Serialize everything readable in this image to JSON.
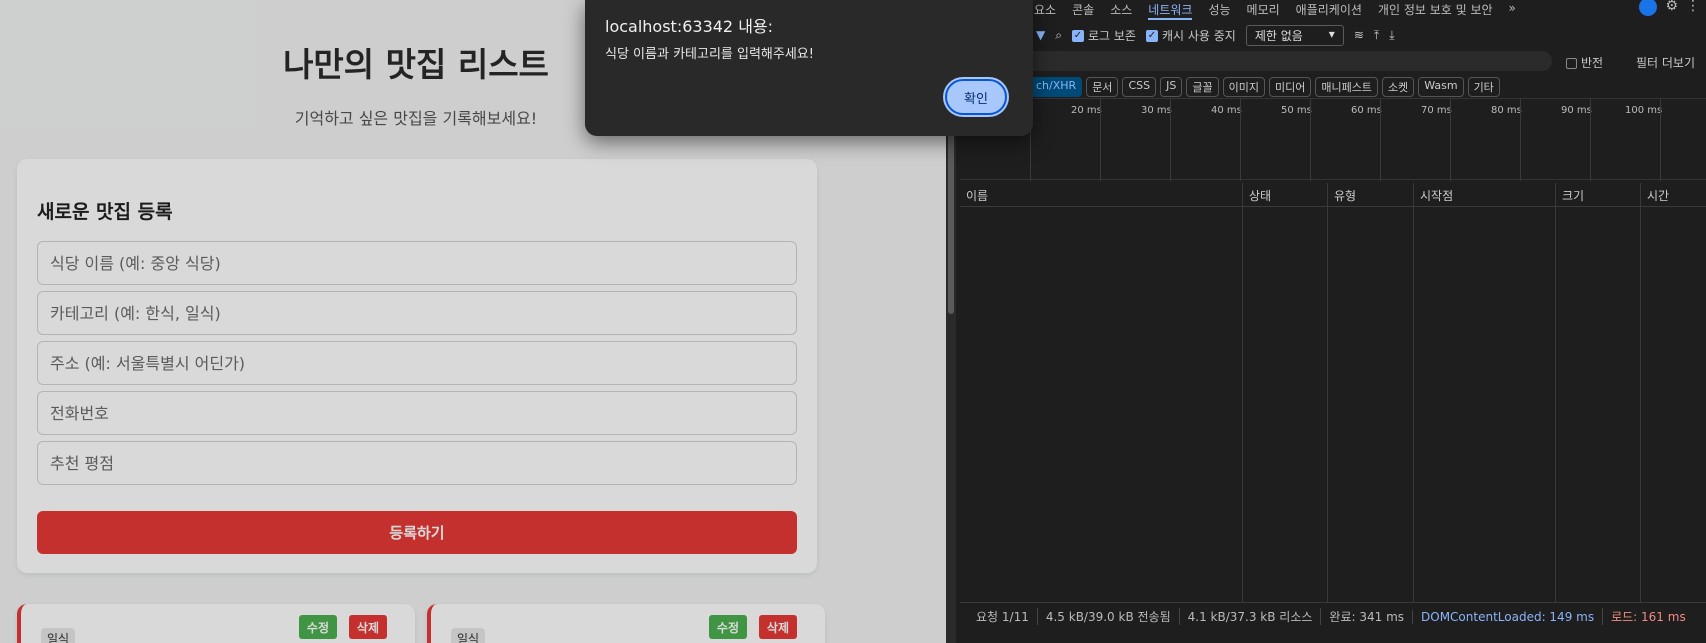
{
  "page": {
    "title": "나만의 맛집 리스트",
    "subtitle": "기억하고 싶은 맛집을 기록해보세요!",
    "form": {
      "title": "새로운 맛집 등록",
      "fields": [
        {
          "placeholder": "식당 이름 (예: 중앙 식당)"
        },
        {
          "placeholder": "카테고리 (예: 한식, 일식)"
        },
        {
          "placeholder": "주소 (예: 서울특별시 어딘가)"
        },
        {
          "placeholder": "전화번호"
        },
        {
          "placeholder": "추천 평점"
        }
      ],
      "submit_label": "등록하기"
    },
    "items": [
      {
        "category": "일식",
        "edit_label": "수정",
        "delete_label": "삭제"
      },
      {
        "category": "일식",
        "edit_label": "수정",
        "delete_label": "삭제"
      }
    ],
    "accent_color": "#e53935",
    "edit_color": "#4caf50"
  },
  "dialog": {
    "title": "localhost:63342 내용:",
    "message": "식당 이름과 카테고리를 입력해주세요!",
    "ok_label": "확인"
  },
  "devtools": {
    "tabs": [
      "요소",
      "콘솔",
      "소스",
      "네트워크",
      "성능",
      "메모리",
      "애플리케이션",
      "개인 정보 보호 및 보안"
    ],
    "active_tab": "네트워크",
    "toolbar": {
      "preserve_log": "로그 보존",
      "disable_cache": "캐시 사용 중지",
      "throttle_value": "제한 없음",
      "invert_label": "반전",
      "more_filters": "필터 더보기"
    },
    "filter_chips": [
      "ch/XHR",
      "문서",
      "CSS",
      "JS",
      "글꼴",
      "이미지",
      "미디어",
      "매니페스트",
      "소켓",
      "Wasm",
      "기타"
    ],
    "timeline_ticks": [
      "20 ms",
      "30 ms",
      "40 ms",
      "50 ms",
      "60 ms",
      "70 ms",
      "80 ms",
      "90 ms",
      "100 ms"
    ],
    "columns": [
      "이름",
      "상태",
      "유형",
      "시작점",
      "크기",
      "시간"
    ],
    "status": {
      "requests": "요청 1/11",
      "transferred": "4.5 kB/39.0 kB 전송됨",
      "resources": "4.1 kB/37.3 kB 리소스",
      "finish": "완료: 341 ms",
      "dom_loaded": "DOMContentLoaded: 149 ms",
      "load": "로드: 161 ms"
    }
  }
}
